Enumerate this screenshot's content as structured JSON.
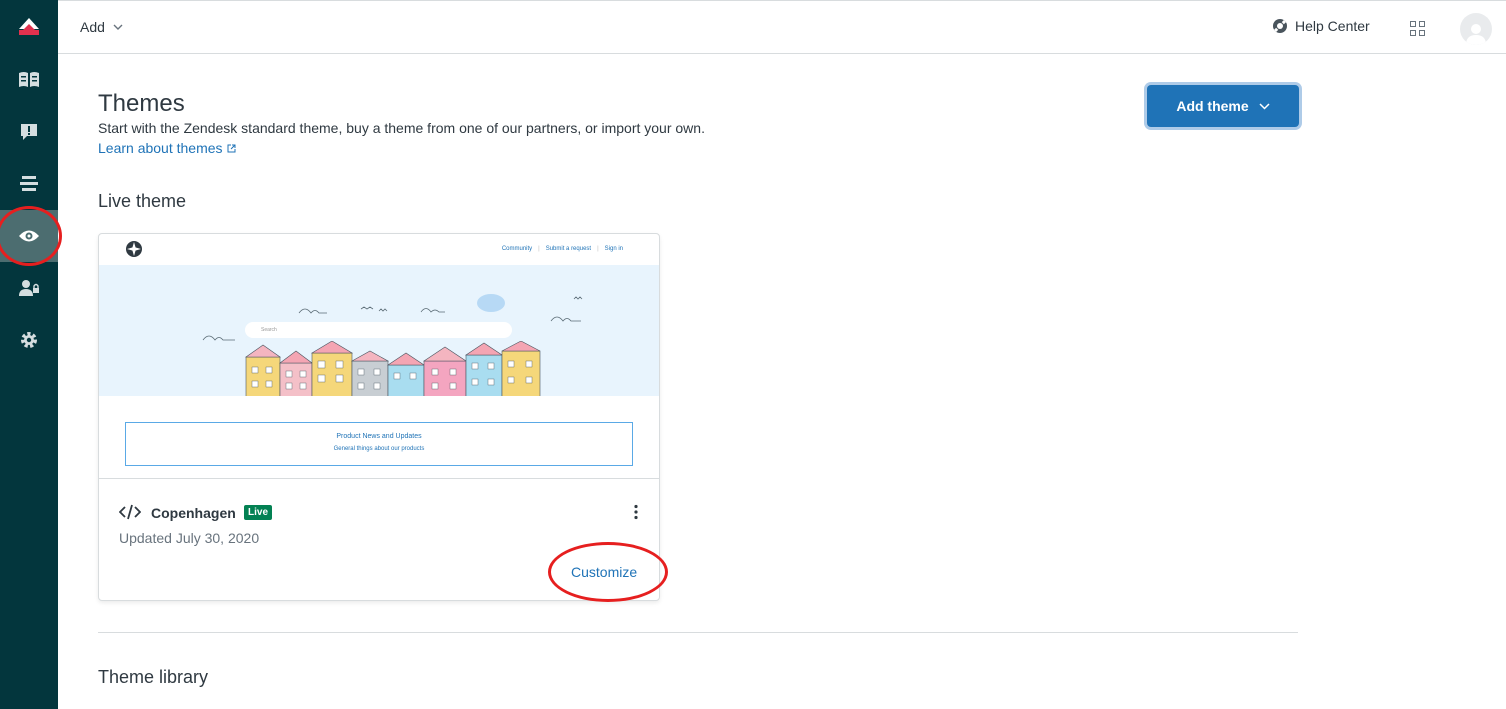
{
  "topbar": {
    "add_label": "Add",
    "help_center_label": "Help Center"
  },
  "sidebar": {
    "items": [
      {
        "icon": "guide-book-icon"
      },
      {
        "icon": "community-alert-icon"
      },
      {
        "icon": "arrange-content-icon"
      },
      {
        "icon": "customize-design-icon",
        "active": true
      },
      {
        "icon": "user-permissions-icon"
      },
      {
        "icon": "settings-gear-icon"
      }
    ]
  },
  "page": {
    "title": "Themes",
    "description": "Start with the Zendesk standard theme, buy a theme from one of our partners, or import your own.",
    "learn_link": "Learn about themes",
    "add_theme_label": "Add theme"
  },
  "live_section": {
    "title": "Live theme"
  },
  "theme_card": {
    "preview": {
      "nav": [
        "Community",
        "Submit a request",
        "Sign in"
      ],
      "search_placeholder": "Search",
      "box_title": "Product News and Updates",
      "box_subtitle": "General things about our products"
    },
    "name": "Copenhagen",
    "badge": "Live",
    "updated": "Updated July 30, 2020",
    "customize_label": "Customize"
  },
  "library_section": {
    "title": "Theme library"
  },
  "colors": {
    "sidebar": "#03363d",
    "accent": "#1f73b7",
    "live_badge": "#038153",
    "annotation": "#e61f1f"
  }
}
